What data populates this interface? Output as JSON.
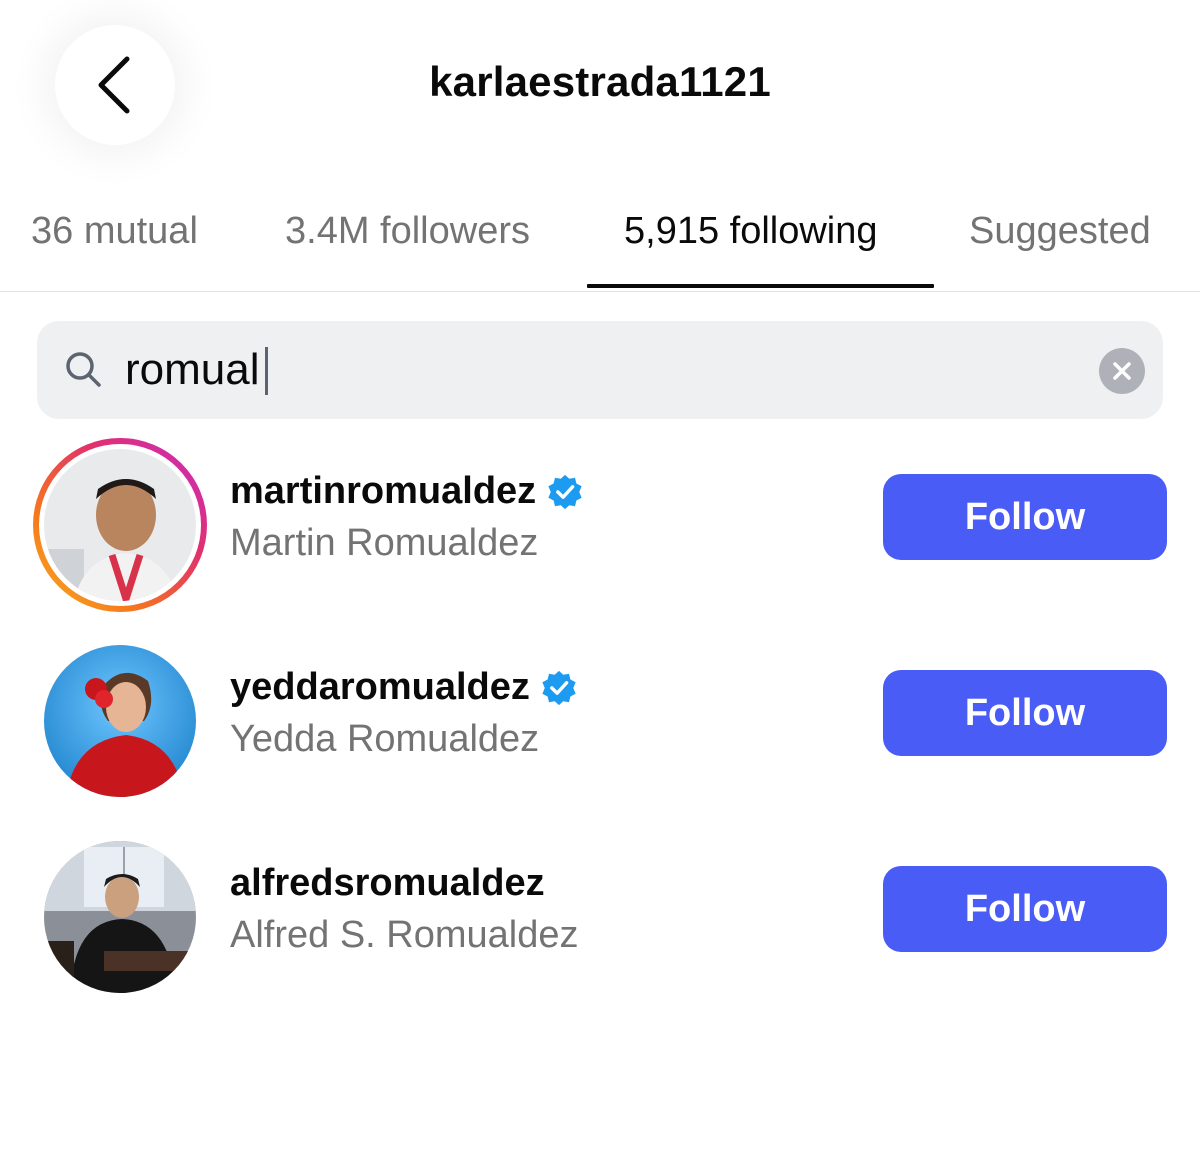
{
  "header": {
    "title": "karlaestrada1121",
    "back_icon": "chevron-left-icon"
  },
  "tabs": [
    {
      "label": "36 mutual",
      "active": false
    },
    {
      "label": "3.4M followers",
      "active": false
    },
    {
      "label": "5,915 following",
      "active": true
    },
    {
      "label": "Suggested",
      "active": false
    }
  ],
  "search": {
    "value": "romual",
    "placeholder": "Search",
    "icon": "search-icon",
    "clear_icon": "close-icon"
  },
  "results": [
    {
      "username": "martinromualdez",
      "name": "Martin Romualdez",
      "verified": true,
      "story_ring": true,
      "button": "Follow"
    },
    {
      "username": "yeddaromualdez",
      "name": "Yedda Romualdez",
      "verified": true,
      "story_ring": false,
      "button": "Follow"
    },
    {
      "username": "alfredsromualdez",
      "name": "Alfred S. Romualdez",
      "verified": false,
      "story_ring": false,
      "button": "Follow"
    }
  ],
  "colors": {
    "accent": "#4a5cf6",
    "verified": "#1d9bf0",
    "muted_text": "#737373",
    "search_bg": "#eff0f2"
  }
}
